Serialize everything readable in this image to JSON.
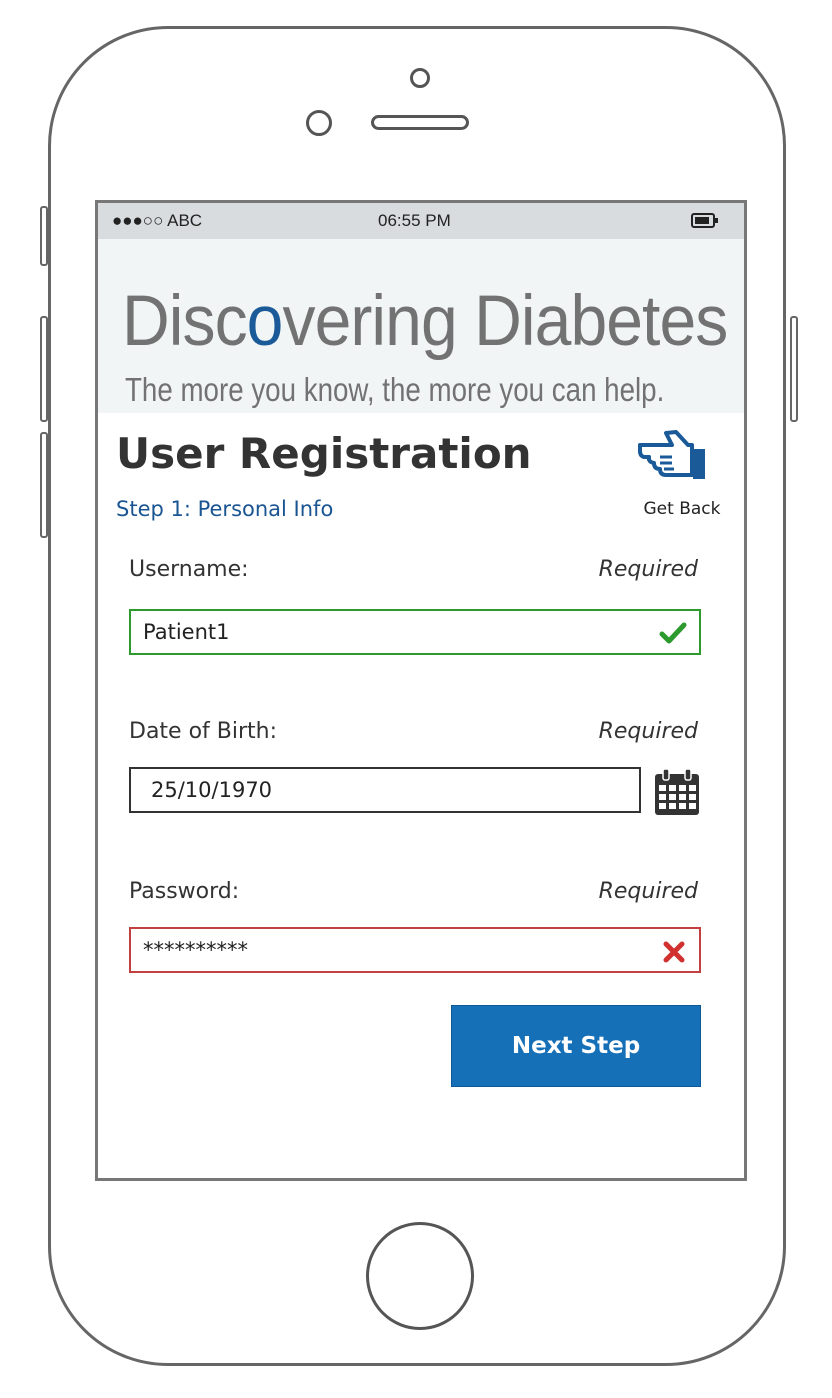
{
  "status_bar": {
    "carrier": "●●●○○ ABC",
    "time": "06:55 PM"
  },
  "banner": {
    "title_pre": "Disc",
    "title_accent": "o",
    "title_post": "vering Diabetes",
    "tagline": "The more you know, the more you can help."
  },
  "header": {
    "title": "User Registration",
    "step": "Step 1: Personal Info",
    "get_back_label": "Get Back"
  },
  "form": {
    "username": {
      "label": "Username:",
      "required": "Required",
      "value": "Patient1",
      "status": "valid"
    },
    "dob": {
      "label": "Date of Birth:",
      "required": "Required",
      "value": "25/10/1970"
    },
    "password": {
      "label": "Password:",
      "required": "Required",
      "value": "**********",
      "status": "invalid"
    }
  },
  "actions": {
    "next_label": "Next Step"
  },
  "colors": {
    "accent": "#1670b8",
    "valid": "#2c9a2c",
    "invalid": "#c24040",
    "step_text": "#1a5592"
  }
}
